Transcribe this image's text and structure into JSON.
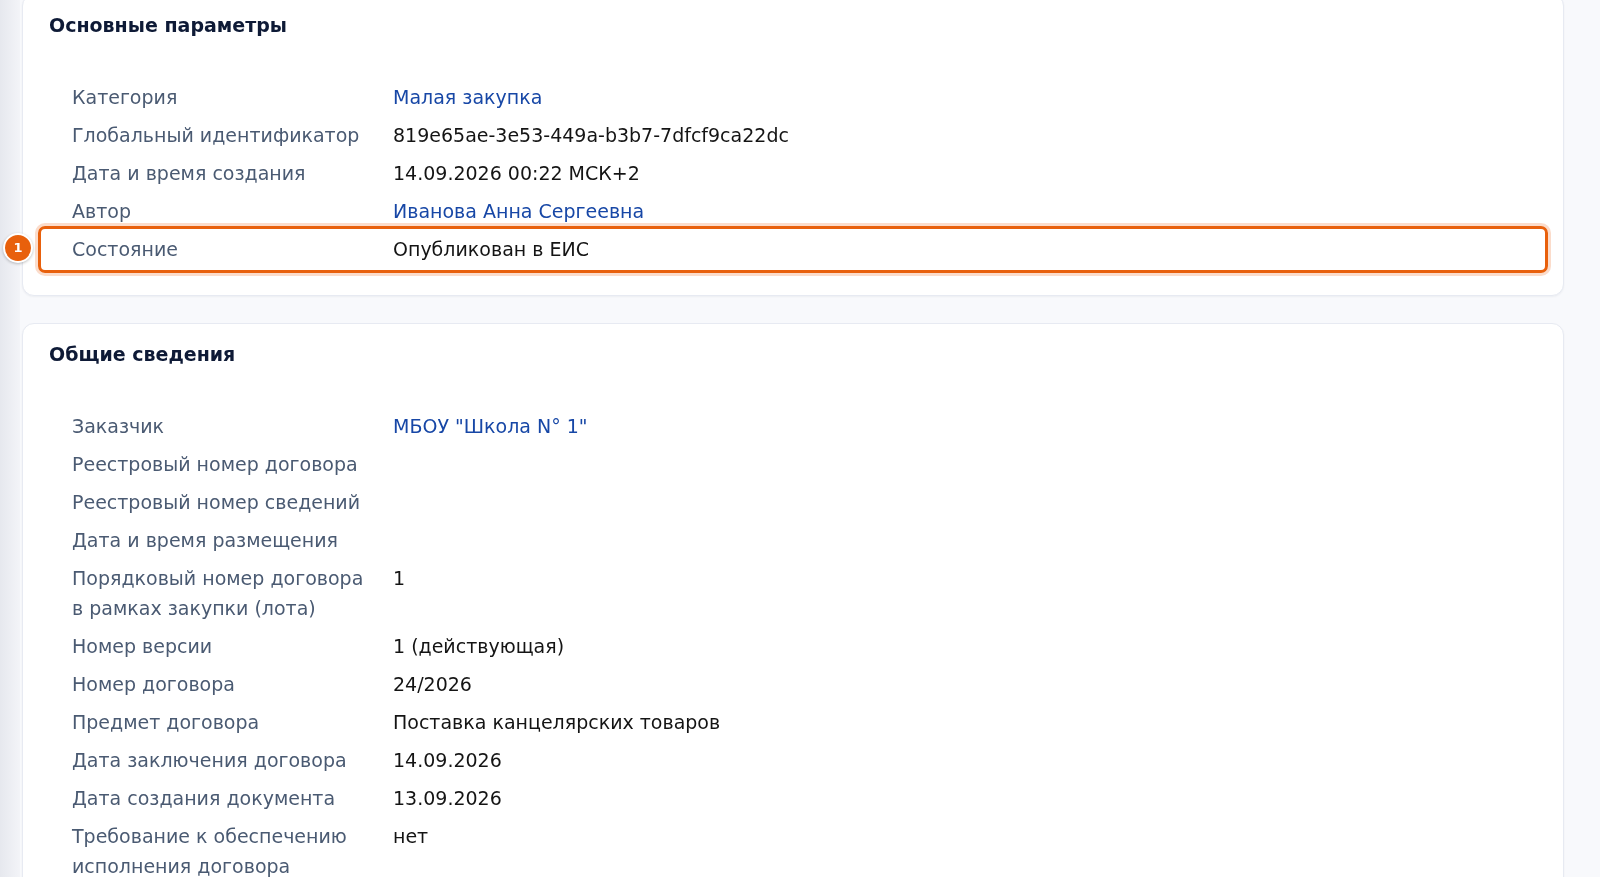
{
  "sections": [
    {
      "title": "Основные параметры",
      "rows": [
        {
          "label": "Категория",
          "value": "Малая закупка",
          "kind": "link",
          "highlighted": false
        },
        {
          "label": "Глобальный идентификатор",
          "value": "819e65ae-3e53-449a-b3b7-7dfcf9ca22dc",
          "kind": "text",
          "highlighted": false
        },
        {
          "label": "Дата и время создания",
          "value": "14.09.2026 00:22 МСК+2",
          "kind": "text",
          "highlighted": false
        },
        {
          "label": "Автор",
          "value": "Иванова Анна Сергеевна",
          "kind": "link",
          "highlighted": false
        },
        {
          "label": "Состояние",
          "value": "Опубликован в ЕИС",
          "kind": "text",
          "highlighted": true,
          "badge": "1"
        }
      ]
    },
    {
      "title": "Общие сведения",
      "rows": [
        {
          "label": "Заказчик",
          "value": "МБОУ \"Школа N° 1\"",
          "kind": "link",
          "highlighted": false
        },
        {
          "label": "Реестровый номер договора",
          "highlighted": false
        },
        {
          "label": "Реестровый номер сведений",
          "highlighted": false
        },
        {
          "label": "Дата и время размещения",
          "highlighted": false
        },
        {
          "label": "Порядковый номер договора в рамках закупки (лота)",
          "value": "1",
          "kind": "text",
          "highlighted": false
        },
        {
          "label": "Номер версии",
          "value": "1 (действующая)",
          "kind": "text",
          "highlighted": false
        },
        {
          "label": "Номер договора",
          "value": "24/2026",
          "kind": "text",
          "highlighted": false
        },
        {
          "label": "Предмет договора",
          "value": "Поставка канцелярских товаров",
          "kind": "text",
          "highlighted": false
        },
        {
          "label": "Дата заключения договора",
          "value": "14.09.2026",
          "kind": "text",
          "highlighted": false
        },
        {
          "label": "Дата создания документа",
          "value": "13.09.2026",
          "kind": "text",
          "highlighted": false
        },
        {
          "label": "Требование к обеспечению исполнения договора",
          "value": "нет",
          "kind": "text",
          "highlighted": false
        }
      ]
    }
  ]
}
